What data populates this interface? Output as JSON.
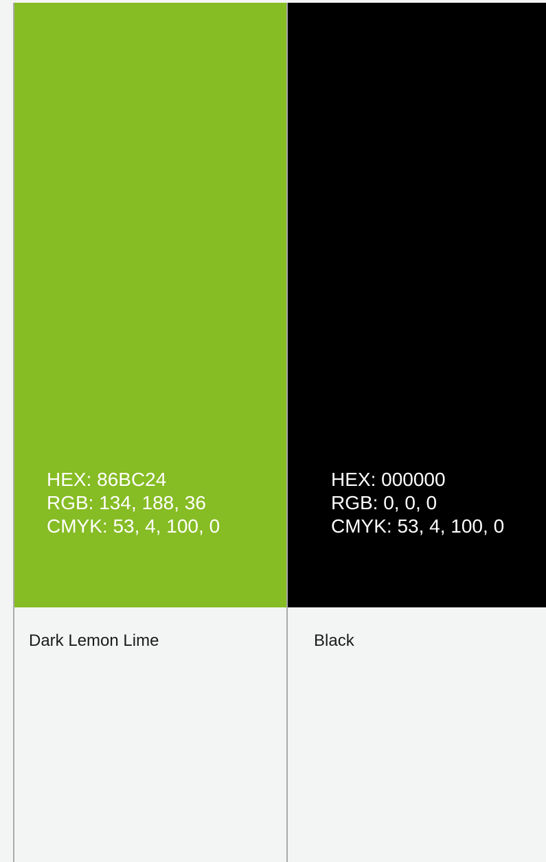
{
  "swatches": [
    {
      "name": "Dark Lemon Lime",
      "color": "#86BC24",
      "hex": "HEX: 86BC24",
      "rgb": "RGB: 134, 188, 36",
      "cmyk": "CMYK: 53, 4, 100, 0"
    },
    {
      "name": "Black",
      "color": "#000000",
      "hex": "HEX: 000000",
      "rgb": "RGB: 0, 0, 0",
      "cmyk": "CMYK: 53, 4, 100, 0"
    }
  ]
}
